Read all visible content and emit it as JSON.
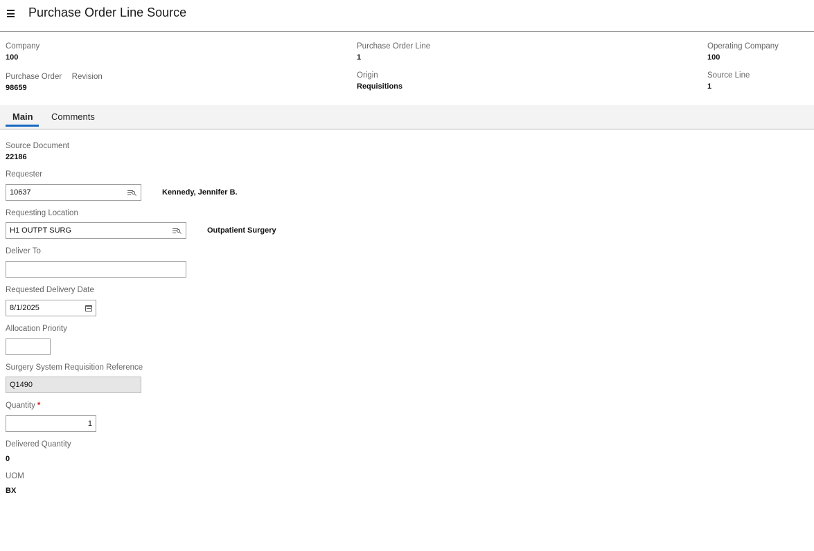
{
  "title": "Purchase Order Line Source",
  "header": {
    "company_label": "Company",
    "company_value": "100",
    "po_label": "Purchase Order",
    "revision_label": "Revision",
    "po_value": "98659",
    "po_line_label": "Purchase Order Line",
    "po_line_value": "1",
    "origin_label": "Origin",
    "origin_value": "Requisitions",
    "op_company_label": "Operating Company",
    "op_company_value": "100",
    "source_line_label": "Source Line",
    "source_line_value": "1"
  },
  "tabs": [
    {
      "label": "Main"
    },
    {
      "label": "Comments"
    }
  ],
  "form": {
    "source_document_label": "Source Document",
    "source_document_value": "22186",
    "requester_label": "Requester",
    "requester_value": "10637",
    "requester_name": "Kennedy, Jennifer B.",
    "requesting_location_label": "Requesting Location",
    "requesting_location_value": "H1 OUTPT SURG",
    "requesting_location_name": "Outpatient Surgery",
    "deliver_to_label": "Deliver To",
    "deliver_to_value": "",
    "delivery_date_label": "Requested Delivery Date",
    "delivery_date_value": "8/1/2025",
    "allocation_priority_label": "Allocation Priority",
    "allocation_priority_value": "",
    "surgery_ref_label": "Surgery System Requisition Reference",
    "surgery_ref_value": "Q1490",
    "quantity_label": "Quantity",
    "quantity_required_mark": "*",
    "quantity_value": "1",
    "delivered_quantity_label": "Delivered Quantity",
    "delivered_quantity_value": "0",
    "uom_label": "UOM",
    "uom_value": "BX"
  },
  "colors": {
    "accent": "#1769c2",
    "required": "#d32020",
    "readonly_bg": "#e6e6e6"
  },
  "icons": [
    "menu-icon",
    "lookup-icon",
    "calendar-icon"
  ]
}
